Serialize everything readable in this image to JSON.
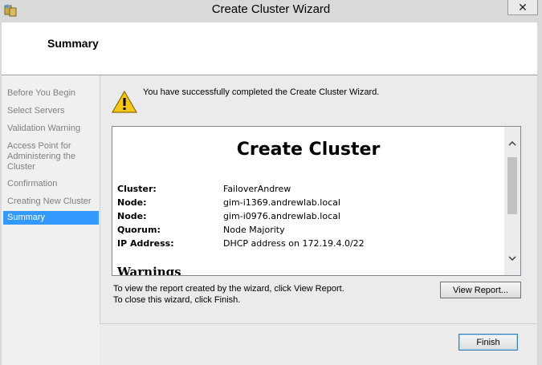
{
  "window": {
    "title": "Create Cluster Wizard",
    "close_label": "✕"
  },
  "header": {
    "title": "Summary"
  },
  "sidebar": {
    "items": [
      {
        "label": "Before You Begin"
      },
      {
        "label": "Select Servers"
      },
      {
        "label": "Validation Warning"
      },
      {
        "label": "Access Point for Administering the Cluster"
      },
      {
        "label": "Confirmation"
      },
      {
        "label": "Creating New Cluster"
      },
      {
        "label": "Summary",
        "active": true
      }
    ]
  },
  "main": {
    "success_message": "You have successfully completed the Create Cluster Wizard.",
    "report": {
      "title": "Create Cluster",
      "rows": [
        {
          "label": "Cluster:",
          "value": "FailoverAndrew"
        },
        {
          "label": "Node:",
          "value": "gim-i1369.andrewlab.local"
        },
        {
          "label": "Node:",
          "value": "gim-i0976.andrewlab.local"
        },
        {
          "label": "Quorum:",
          "value": "Node Majority"
        },
        {
          "label": "IP Address:",
          "value": "DHCP address on 172.19.4.0/22"
        }
      ],
      "warnings_heading": "Warnings"
    },
    "help_view": "To view the report created by the wizard, click View Report.",
    "help_close": "To close this wizard, click Finish.",
    "view_report_label": "View Report...",
    "finish_label": "Finish"
  },
  "colors": {
    "selection": "#3399ff",
    "warning": "#f5c518"
  }
}
